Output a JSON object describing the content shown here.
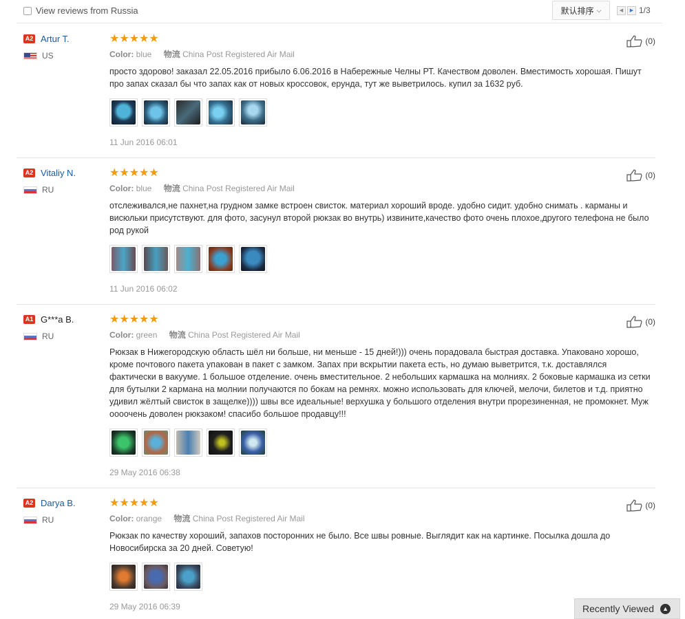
{
  "header": {
    "filter_label": "View reviews from Russia",
    "sort_label": "默认排序",
    "page_indicator": "1/3"
  },
  "reviews": [
    {
      "level": "A2",
      "name": "Artur T.",
      "country": "US",
      "rating": 5,
      "stars": "★★★★★",
      "color_label": "Color:",
      "color_value": "blue",
      "shipping_label": "物流",
      "shipping_value": "China Post Registered Air Mail",
      "text": "просто здорово! заказал 22.05.2016 прибыло 6.06.2016 в Набережные Челны РТ. Качеством доволен. Вместимость хорошая. Пишут про запах сказал бы что запах как от новых кроссовок, ерунда, тут же выветрилось. купил за 1632 руб.",
      "photo_count": 5,
      "date": "11 Jun 2016 06:01",
      "likes": "(0)"
    },
    {
      "level": "A2",
      "name": "Vitaliy N.",
      "country": "RU",
      "rating": 5,
      "stars": "★★★★★",
      "color_label": "Color:",
      "color_value": "blue",
      "shipping_label": "物流",
      "shipping_value": "China Post Registered Air Mail",
      "text": "отслеживался,не пахнет,на грудном замке встроен свисток. материал хороший вроде. удобно сидит. удобно снимать . карманы и висюльки присутствуют. для фото, засунул второй рюкзак во внутрь) извините,качество фото очень плохое,другого телефона не было род рукой",
      "photo_count": 5,
      "date": "11 Jun 2016 06:02",
      "likes": "(0)"
    },
    {
      "level": "A1",
      "name": "G***a B.",
      "country": "RU",
      "rating": 5,
      "stars": "★★★★★",
      "color_label": "Color:",
      "color_value": "green",
      "shipping_label": "物流",
      "shipping_value": "China Post Registered Air Mail",
      "text": "Рюкзак в Нижегородскую область шёл ни больше, ни меньше - 15 дней!))) очень порадовала быстрая доставка. Упаковано хорошо, кроме почтового пакета упакован в пакет с замком. Запах при вскрытии пакета есть, но думаю выветрится, т.к. доставлялся фактически в вакууме. 1 большое отделение. очень вместительное. 2 небольших кармашка на молниях. 2 боковые кармашка из сетки для бутылки 2 кармана на молнии получаются по бокам на ремнях. можно использовать для ключей, мелочи, билетов и т.д. приятно удивил жёлтый свисток в защелке)))) швы все идеальные! верхушка у большого отделения внутри прорезиненная, не промокнет. Муж оооочень доволен рюкзаком! спасибо большое продавцу!!!",
      "photo_count": 5,
      "date": "29 May 2016 06:38",
      "likes": "(0)"
    },
    {
      "level": "A2",
      "name": "Darya B.",
      "country": "RU",
      "rating": 5,
      "stars": "★★★★★",
      "color_label": "Color:",
      "color_value": "orange",
      "shipping_label": "物流",
      "shipping_value": "China Post Registered Air Mail",
      "text": "Рюкзак по качеству хороший, запахов посторонних не было. Все швы ровные. Выглядит как на картинке. Посылка дошла до Новосибирска за 20 дней. Советую!",
      "photo_count": 3,
      "date": "29 May 2016 06:39",
      "likes": "(0)"
    }
  ],
  "recently_viewed": {
    "label": "Recently Viewed"
  },
  "icons": {
    "checkbox": "checkbox-icon",
    "sort_chevron": "chevron-down-icon",
    "prev_page": "chevron-left-icon",
    "next_page": "chevron-right-icon",
    "like": "thumbs-up-icon",
    "recent_toggle": "chevron-up-icon"
  },
  "colors": {
    "level_badge": "#d9351f",
    "username_link": "#1a5aa0",
    "stars": "#f59a0c"
  }
}
